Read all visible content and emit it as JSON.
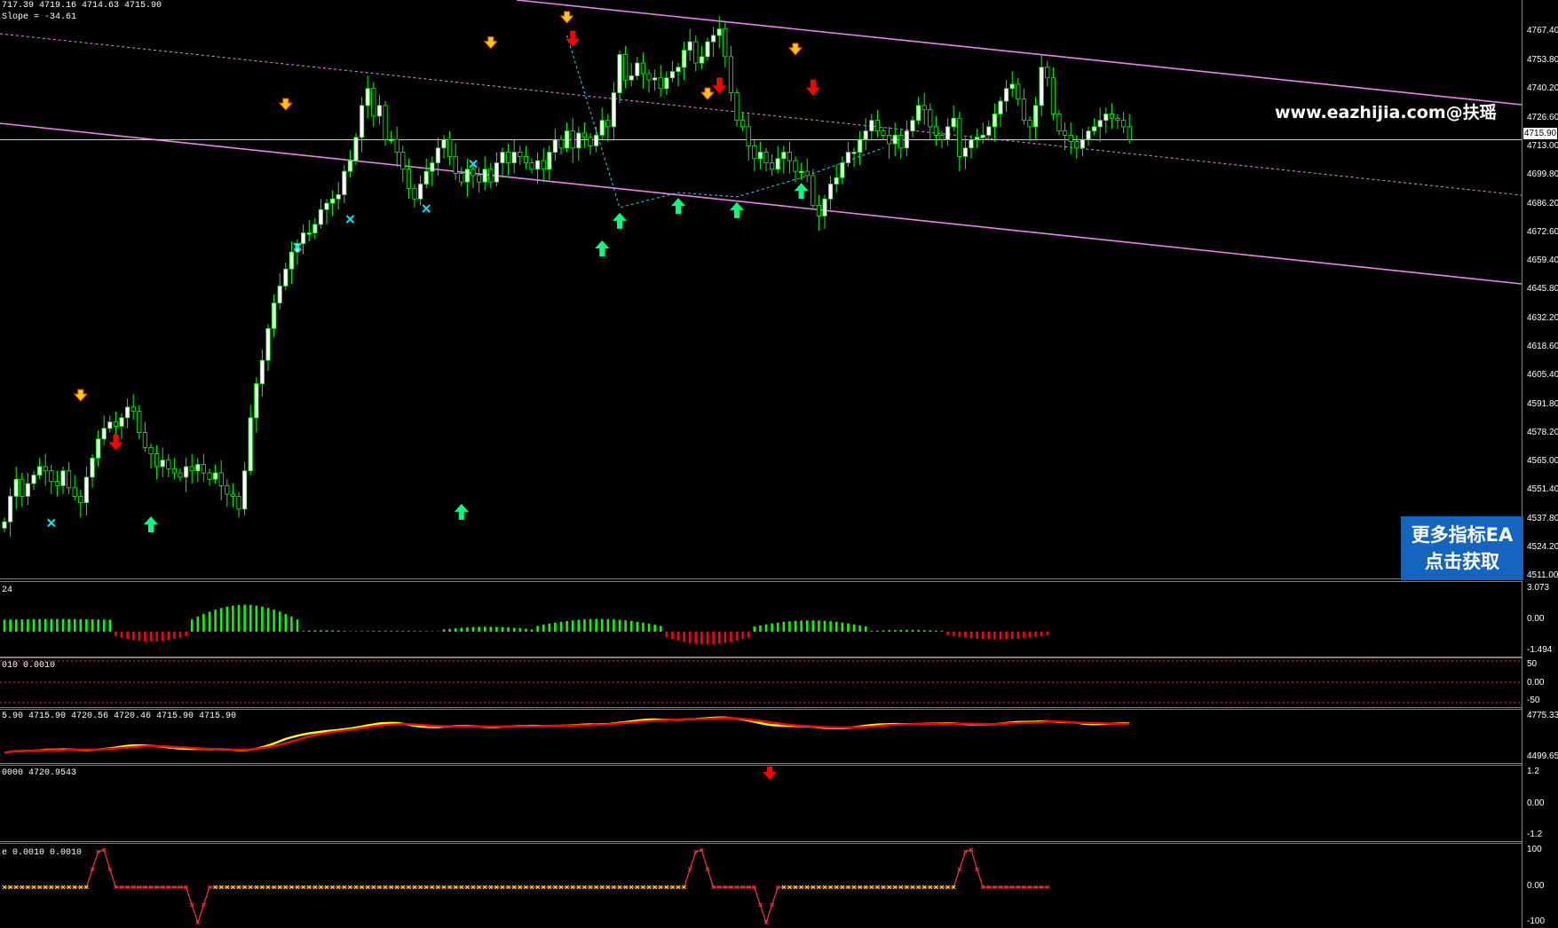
{
  "header": {
    "ohlc": "717.39 4719.16 4714.63 4715.90",
    "slope": "Slope = -34.61"
  },
  "watermark": "www.eazhijia.com@扶瑶",
  "promo": {
    "line1": "更多指标EA",
    "line2": "点击获取"
  },
  "current_price": "4715.90",
  "colors": {
    "background": "#000000",
    "bull_candle": "#ffffff",
    "candle_wick": "#00ff00",
    "channel": "#ee82ee",
    "hist_up": "#00ff00",
    "hist_down": "#ff0000",
    "ma_fast": "#ffff00",
    "ma_slow": "#ff0000",
    "arrow_up": "#00ff7f",
    "arrow_down": "#ff0000",
    "cross": "#00e5ff",
    "promo_bg": "#1565c0"
  },
  "chart_data": [
    {
      "type": "candlestick",
      "ylim": [
        4511.0,
        4780.0
      ],
      "y_ticks": [
        "4767.40",
        "4753.80",
        "4740.20",
        "4726.60",
        "4713.00",
        "4699.80",
        "4686.20",
        "4672.60",
        "4659.40",
        "4645.80",
        "4632.20",
        "4618.60",
        "4605.40",
        "4591.80",
        "4578.20",
        "4565.00",
        "4551.40",
        "4537.80",
        "4524.20",
        "4511.00"
      ],
      "close": [
        4536,
        4548,
        4556,
        4548,
        4554,
        4558,
        4562,
        4560,
        4555,
        4553,
        4560,
        4552,
        4548,
        4545,
        4557,
        4566,
        4575,
        4580,
        4583,
        4581,
        4585,
        4590,
        4588,
        4578,
        4571,
        4568,
        4562,
        4565,
        4561,
        4559,
        4557,
        4562,
        4560,
        4563,
        4559,
        4556,
        4559,
        4553,
        4549,
        4548,
        4542,
        4560,
        4585,
        4601,
        4612,
        4627,
        4639,
        4647,
        4655,
        4663,
        4667,
        4672,
        4672,
        4676,
        4683,
        4686,
        4688,
        4690,
        4701,
        4706,
        4717,
        4732,
        4740,
        4727,
        4732,
        4716,
        4716,
        4710,
        4702,
        4693,
        4688,
        4695,
        4701,
        4705,
        4712,
        4716,
        4708,
        4700,
        4696,
        4702,
        4699,
        4696,
        4702,
        4696,
        4705,
        4710,
        4705,
        4710,
        4708,
        4705,
        4702,
        4706,
        4702,
        4710,
        4716,
        4712,
        4720,
        4712,
        4719,
        4717,
        4713,
        4718,
        4725,
        4722,
        4738,
        4756,
        4744,
        4746,
        4752,
        4747,
        4744,
        4745,
        4740,
        4745,
        4748,
        4750,
        4758,
        4762,
        4752,
        4755,
        4762,
        4765,
        4768,
        4755,
        4738,
        4725,
        4722,
        4713,
        4707,
        4710,
        4705,
        4702,
        4707,
        4710,
        4706,
        4701,
        4701,
        4699,
        4685,
        4680,
        4688,
        4695,
        4698,
        4705,
        4710,
        4710,
        4716,
        4720,
        4725,
        4720,
        4718,
        4714,
        4718,
        4712,
        4720,
        4725,
        4732,
        4730,
        4722,
        4718,
        4716,
        4722,
        4726,
        4708,
        4712,
        4716,
        4717,
        4718,
        4722,
        4728,
        4734,
        4740,
        4742,
        4735,
        4725,
        4722,
        4732,
        4750,
        4745,
        4728,
        4720,
        4718,
        4715,
        4712,
        4716,
        4720,
        4722,
        4725,
        4728,
        4726,
        4725,
        4722,
        4716
      ],
      "markers": {
        "up_arrows": [
          [
            25,
            4541
          ],
          [
            78,
            4547
          ],
          [
            102,
            4671
          ],
          [
            105,
            4684
          ],
          [
            115,
            4691
          ],
          [
            125,
            4689
          ],
          [
            136,
            4698
          ]
        ],
        "down_arrows": [
          [
            19,
            4568
          ],
          [
            97,
            4758
          ],
          [
            122,
            4736
          ],
          [
            138,
            4735
          ]
        ],
        "yellow_flags": [
          [
            13,
            4592
          ],
          [
            48,
            4729
          ],
          [
            83,
            4758
          ],
          [
            96,
            4770
          ],
          [
            120,
            4734
          ],
          [
            135,
            4755
          ]
        ],
        "crosses": [
          [
            8,
            4538
          ],
          [
            50,
            4668
          ],
          [
            59,
            4681
          ],
          [
            72,
            4686
          ],
          [
            80,
            4707
          ]
        ]
      },
      "channel": "descending",
      "horizontal_line": 4715.9
    },
    {
      "type": "histogram",
      "header": "24",
      "ylim": [
        -1.494,
        3.073
      ],
      "y_ticks": [
        "3.073",
        "0.00",
        "-1.494"
      ]
    },
    {
      "type": "line",
      "header": "010 0.0010",
      "ylim": [
        -50,
        50
      ],
      "y_ticks": [
        "50",
        "0.00",
        "-50"
      ]
    },
    {
      "type": "line",
      "header": "5.90 4715.90 4720.56 4720.46 4715.90 4715.90",
      "ylim": [
        4499.65,
        4775.33
      ],
      "y_ticks": [
        "4775.33",
        "4499.65"
      ]
    },
    {
      "type": "line",
      "header": "0000 4720.9543",
      "ylim": [
        -1.2,
        1.2
      ],
      "y_ticks": [
        "1.2",
        "0.00",
        "-1.2"
      ]
    },
    {
      "type": "line",
      "header": "e 0.0010 0.0010",
      "ylim": [
        -100,
        100
      ],
      "y_ticks": [
        "100",
        "0.00",
        "-100"
      ]
    }
  ]
}
